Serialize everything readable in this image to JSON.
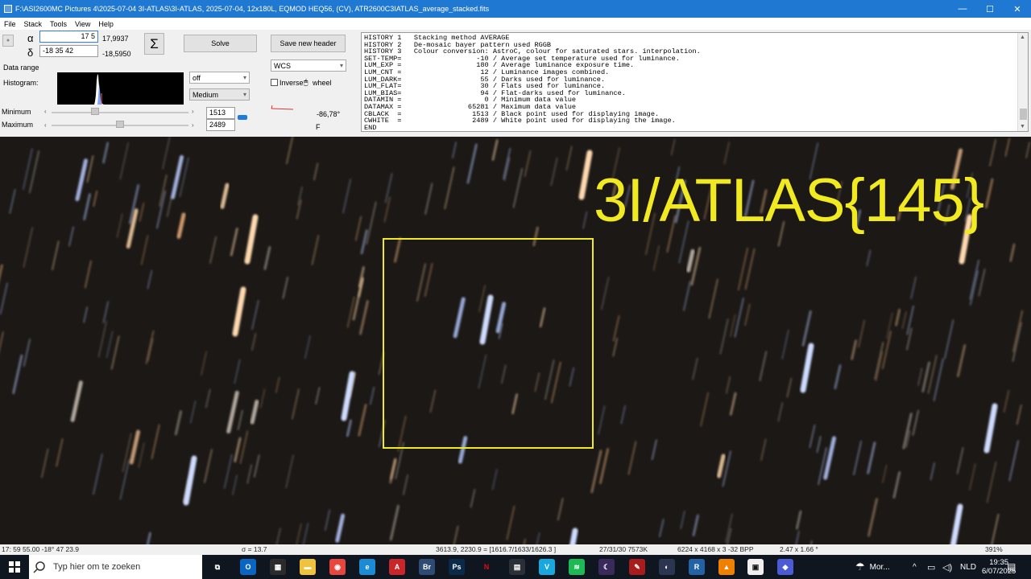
{
  "window": {
    "title": "F:\\ASI2600MC Pictures 4\\2025-07-04 3I-ATLAS\\3I-ATLAS, 2025-07-04, 12x180L, EQMOD HEQ56, (CV), ATR2600C3IATLAS_average_stacked.fits",
    "minimize": "—",
    "maximize": "☐",
    "close": "✕"
  },
  "menu": [
    "File",
    "Stack",
    "Tools",
    "View",
    "Help"
  ],
  "coords": {
    "alpha_symbol": "α",
    "delta_symbol": "δ",
    "alpha_input": "17 5",
    "alpha_value": "17,9937",
    "delta_input": "-18 35 42",
    "delta_value": "-18,5950",
    "sigma": "Σ"
  },
  "buttons": {
    "solve": "Solve",
    "save_header": "Save new header"
  },
  "wcs_select": "WCS",
  "checkbox": {
    "inverse_label": "Inverse",
    "wheel_label": "wheel",
    "mouse_glyph": "🖱"
  },
  "orientation": {
    "angle": "-86,78°",
    "flip": "F"
  },
  "data_range": {
    "label": "Data range",
    "histogram_label": "Histogram:",
    "mode_select": "off",
    "quality_select": "Medium",
    "minimum_label": "Minimum",
    "maximum_label": "Maximum",
    "minimum_value": "1513",
    "maximum_value": "2489",
    "left_arrow": "‹",
    "right_arrow": "›"
  },
  "fits_header": [
    "HISTORY 1   Stacking method AVERAGE",
    "HISTORY 2   De-mosaic bayer pattern used RGGB",
    "HISTORY 3   Colour conversion: AstroC, colour for saturated stars. interpolation.",
    "SET-TEMP=                  -10 / Average set temperature used for luminance.",
    "LUM_EXP =                  180 / Average luminance exposure time.",
    "LUM_CNT =                   12 / Luminance images combined.",
    "LUM_DARK=                   55 / Darks used for luminance.",
    "LUM_FLAT=                   30 / Flats used for luminance.",
    "LUM_BIAS=                   94 / Flat-darks used for luminance.",
    "DATAMIN =                    0 / Minimum data value",
    "DATAMAX =                65281 / Maximum data value",
    "CBLACK  =                 1513 / Black point used for displaying image.",
    "CWHITE  =                 2489 / White point used for displaying the image.",
    "END"
  ],
  "image": {
    "annotation": "3I/ATLAS{145}",
    "annotation_color": "#f1ea21",
    "background_color": "#1b1815"
  },
  "status": {
    "radec": "17: 59  55.00   -18° 47  23.9",
    "sigma": "σ = 13.7",
    "pixel": "3613.9, 2230.9 = [1616.7/1633/1626.3 ]",
    "exposure": "27/31/30  7573K",
    "dims": "6224 x 4168 x 3   -32 BPP",
    "scale": "2.47 x 1.66 °",
    "zoom": "391%"
  },
  "taskbar": {
    "search_placeholder": "Typ hier om te zoeken",
    "weather": "Mor...",
    "language": "NLD",
    "time": "19:35",
    "date": "6/07/2025",
    "apps": [
      "task-view",
      "outlook",
      "store",
      "explorer",
      "chrome",
      "edge",
      "acrobat",
      "bridge",
      "photoshop",
      "netflix",
      "calculator",
      "vimeo",
      "spotify",
      "astro",
      "pdf",
      "stellarium",
      "r",
      "vlc",
      "astap",
      "shield"
    ]
  }
}
